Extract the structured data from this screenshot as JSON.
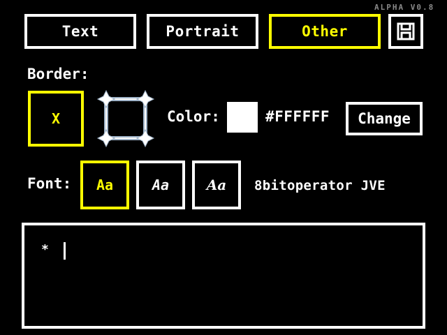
{
  "version": "ALPHA V0.8",
  "tabs": [
    {
      "label": "Text"
    },
    {
      "label": "Portrait"
    },
    {
      "label": "Other"
    }
  ],
  "save_icon": "floppy-disk-icon",
  "border": {
    "label": "Border:",
    "none_option": "X"
  },
  "color": {
    "label": "Color:",
    "value": "#FFFFFF",
    "swatch": "#FFFFFF",
    "change_label": "Change"
  },
  "font": {
    "label": "Font:",
    "options": [
      "Aa",
      "Aa",
      "Aa"
    ],
    "selected_name": "8bitoperator JVE"
  },
  "textbox": {
    "prompt": "*"
  },
  "colors": {
    "accent": "#FFFF00",
    "foreground": "#FFFFFF",
    "background": "#000000",
    "muted": "#8A8A8A"
  }
}
